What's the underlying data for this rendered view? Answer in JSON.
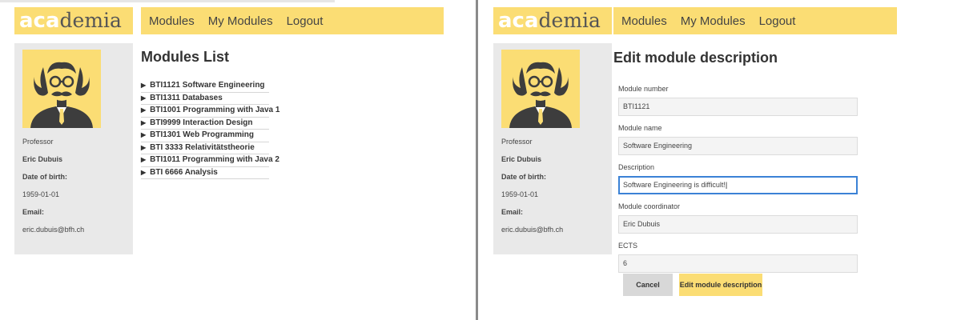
{
  "logo": {
    "part1": "aca",
    "part2": "demia"
  },
  "nav": {
    "modules": "Modules",
    "my_modules": "My Modules",
    "logout": "Logout"
  },
  "sidebar": {
    "role": "Professor",
    "name": "Eric Dubuis",
    "dob_label": "Date of birth:",
    "dob": "1959-01-01",
    "email_label": "Email:",
    "email": "eric.dubuis@bfh.ch"
  },
  "left_page": {
    "title": "Modules List",
    "modules": [
      "BTI1121 Software Engineering",
      "BTI1311 Databases",
      "BTI1001 Programming with Java 1",
      "BTI9999 Interaction Design",
      "BTI1301 Web Programming",
      "BTI 3333 Relativitätstheorie",
      "BTI1011 Programming with Java 2",
      "BTI 6666 Analysis"
    ]
  },
  "right_page": {
    "title": "Edit module description",
    "fields": {
      "number": {
        "label": "Module number",
        "value": "BTI1121"
      },
      "name": {
        "label": "Module name",
        "value": "Software Engineering"
      },
      "description": {
        "label": "Description",
        "value": "Software Engineering is difficult!"
      },
      "coordinator": {
        "label": "Module coordinator",
        "value": "Eric Dubuis"
      },
      "ects": {
        "label": "ECTS",
        "value": "6"
      }
    },
    "cancel_label": "Cancel",
    "submit_label": "Edit module description"
  },
  "colors": {
    "accent_yellow": "#fbdd74",
    "sidebar_gray": "#e9e9e9",
    "focus_blue": "#3b82d6"
  }
}
